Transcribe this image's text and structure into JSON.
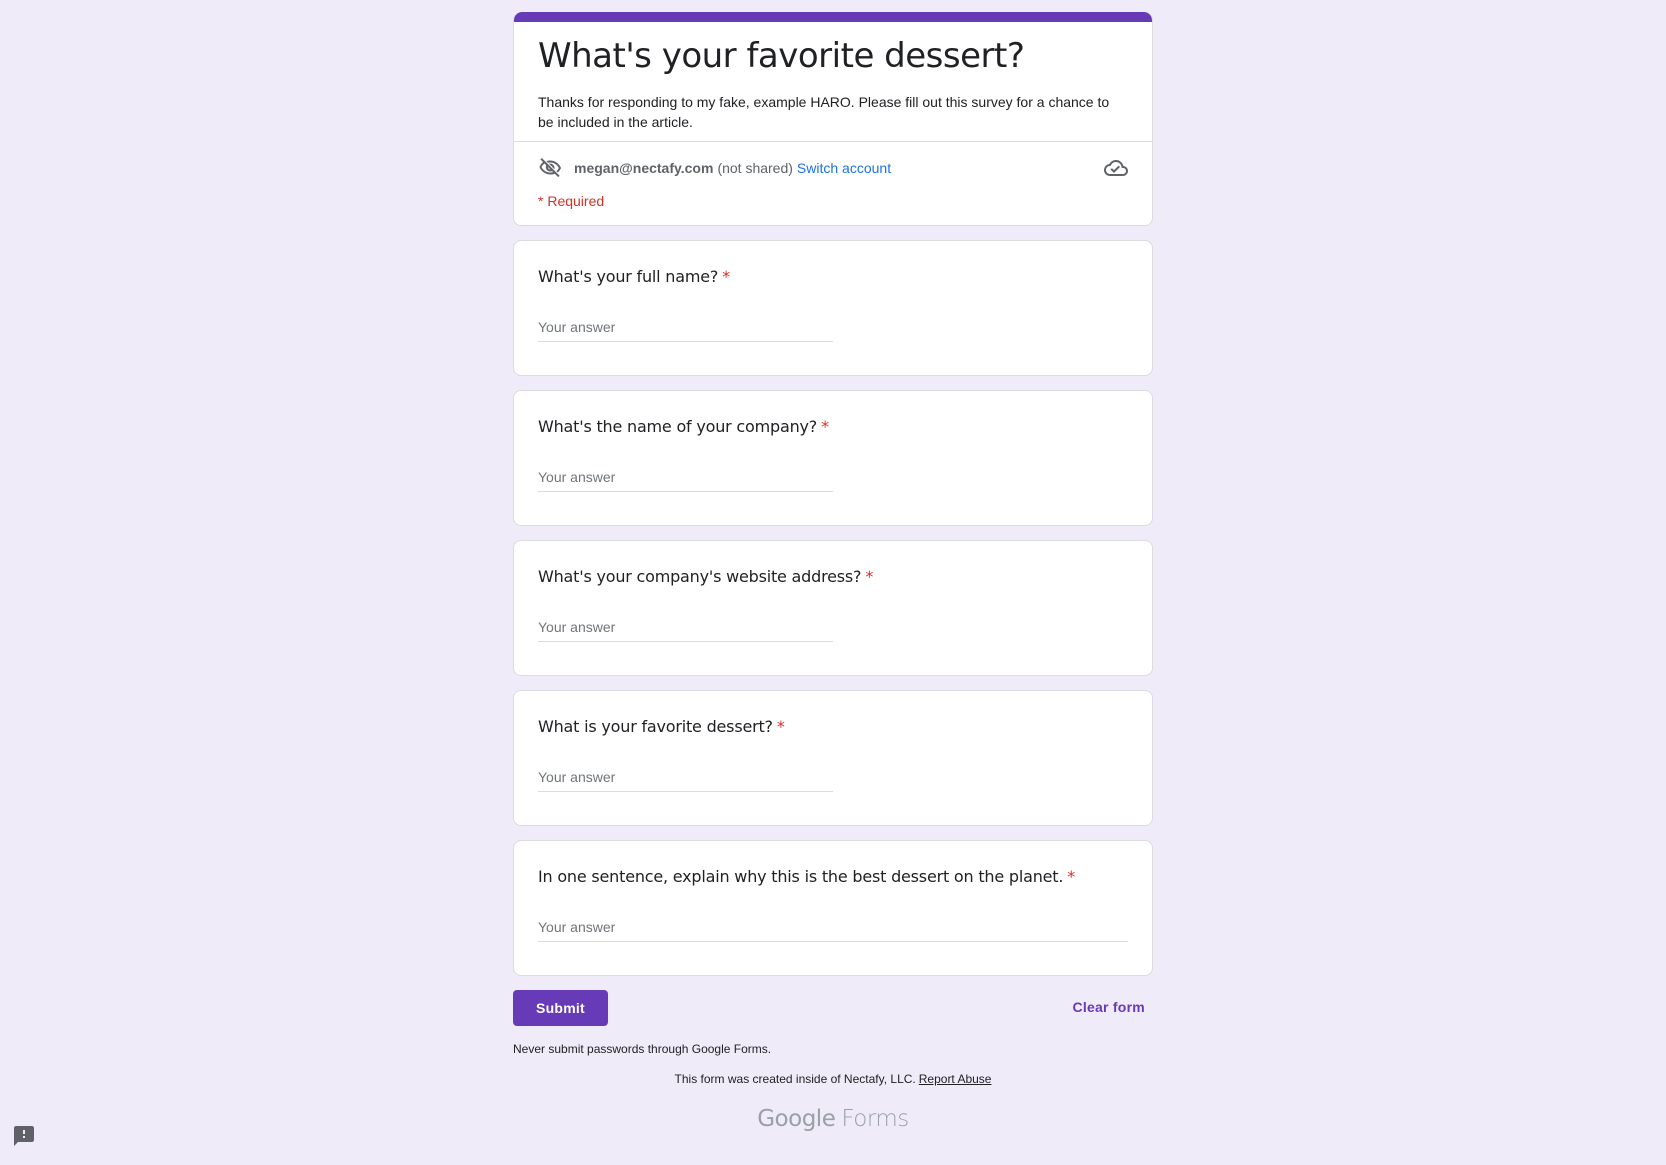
{
  "form": {
    "title": "What's your favorite dessert?",
    "description": "Thanks for responding to my fake, example HARO. Please fill out this survey for a chance to be included in the article.",
    "accent_color": "#673ab7"
  },
  "account": {
    "email": "megan@nectafy.com",
    "not_shared": "(not shared)",
    "switch_label": "Switch account",
    "eye_icon": "eye-off-icon",
    "cloud_icon": "cloud-done-icon"
  },
  "required_note": "* Required",
  "questions": [
    {
      "title": "What's your full name?",
      "required": "*",
      "placeholder": "Your answer",
      "value": ""
    },
    {
      "title": "What's the name of your company?",
      "required": "*",
      "placeholder": "Your answer",
      "value": ""
    },
    {
      "title": "What's your company's website address?",
      "required": "*",
      "placeholder": "Your answer",
      "value": ""
    },
    {
      "title": "What is your favorite dessert?",
      "required": "*",
      "placeholder": "Your answer",
      "value": ""
    },
    {
      "title": "In one sentence, explain why this is the best dessert on the planet.",
      "required": "*",
      "placeholder": "Your answer",
      "value": ""
    }
  ],
  "actions": {
    "submit_label": "Submit",
    "clear_label": "Clear form"
  },
  "footer": {
    "warning": "Never submit passwords through Google Forms.",
    "created_text": "This form was created inside of Nectafy, LLC.",
    "report_abuse": "Report Abuse",
    "logo_google": "Google",
    "logo_forms": "Forms"
  },
  "feedback_icon": "report-feedback-icon"
}
